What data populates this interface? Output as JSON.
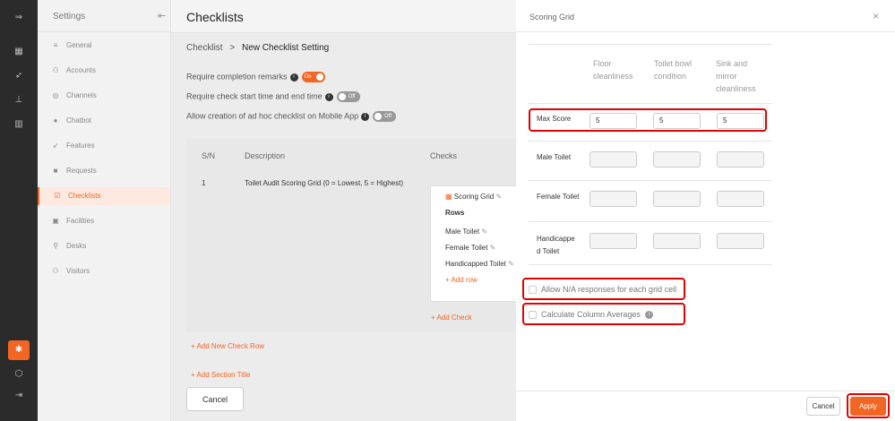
{
  "rail": {
    "colors": {
      "bg": "#2b2b2b",
      "accent": "#f26522"
    },
    "icons": [
      "expand-icon",
      "dashboard-icon",
      "rocket-icon",
      "analytics-icon",
      "bar-chart-icon",
      "settings-icon",
      "cube-icon",
      "logout-icon"
    ]
  },
  "sidebar": {
    "title": "Settings",
    "items": [
      {
        "label": "General",
        "icon": "sliders-icon"
      },
      {
        "label": "Accounts",
        "icon": "users-icon"
      },
      {
        "label": "Channels",
        "icon": "channels-icon"
      },
      {
        "label": "Chatbot",
        "icon": "chatbot-icon"
      },
      {
        "label": "Features",
        "icon": "rocket-icon"
      },
      {
        "label": "Requests",
        "icon": "requests-icon"
      },
      {
        "label": "Checklists",
        "icon": "checklist-icon"
      },
      {
        "label": "Facilities",
        "icon": "facilities-icon"
      },
      {
        "label": "Desks",
        "icon": "desks-icon"
      },
      {
        "label": "Visitors",
        "icon": "visitors-icon"
      }
    ]
  },
  "main": {
    "title": "Checklists",
    "breadcrumb": {
      "parent": "Checklist",
      "separator": ">",
      "current": "New Checklist Setting"
    },
    "toggles": [
      {
        "label": "Require completion remarks",
        "state": "On"
      },
      {
        "label": "Require check start time and end time",
        "state": "Off"
      },
      {
        "label": "Allow creation of ad hoc checklist on Mobile App",
        "state": "Off"
      }
    ],
    "table": {
      "headers": [
        "S/N",
        "Description",
        "Checks"
      ],
      "row": {
        "sn": "1",
        "description": "Toilet Audit Scoring Grid (0 = Lowest, 5 = Highest)"
      },
      "card": {
        "title": "Scoring Grid",
        "rows_label": "Rows",
        "rows": [
          "Male Toilet",
          "Female Toilet",
          "Handicapped Toilet"
        ],
        "add_row": "+ Add row"
      },
      "add_check": "+ Add Check"
    },
    "add_check_row": "+ Add New Check Row",
    "add_section": "+ Add Section Title",
    "cancel": "Cancel"
  },
  "panel": {
    "title": "Scoring Grid",
    "close": "×",
    "columns": [
      "Floor cleanliness",
      "Toilet bowl condition",
      "Sink and mirror cleanliness"
    ],
    "rows": [
      {
        "label": "Max Score",
        "values": [
          "5",
          "5",
          "5"
        ]
      },
      {
        "label": "Male Toilet",
        "values": [
          "",
          "",
          ""
        ]
      },
      {
        "label": "Female Toilet",
        "values": [
          "",
          "",
          ""
        ]
      },
      {
        "label": "Handicapped Toilet",
        "values": [
          "",
          "",
          ""
        ]
      }
    ],
    "allow_na": "Allow N/A responses for each grid cell",
    "calc_avg": "Calculate Column Averages",
    "cancel": "Cancel",
    "apply": "Apply"
  }
}
